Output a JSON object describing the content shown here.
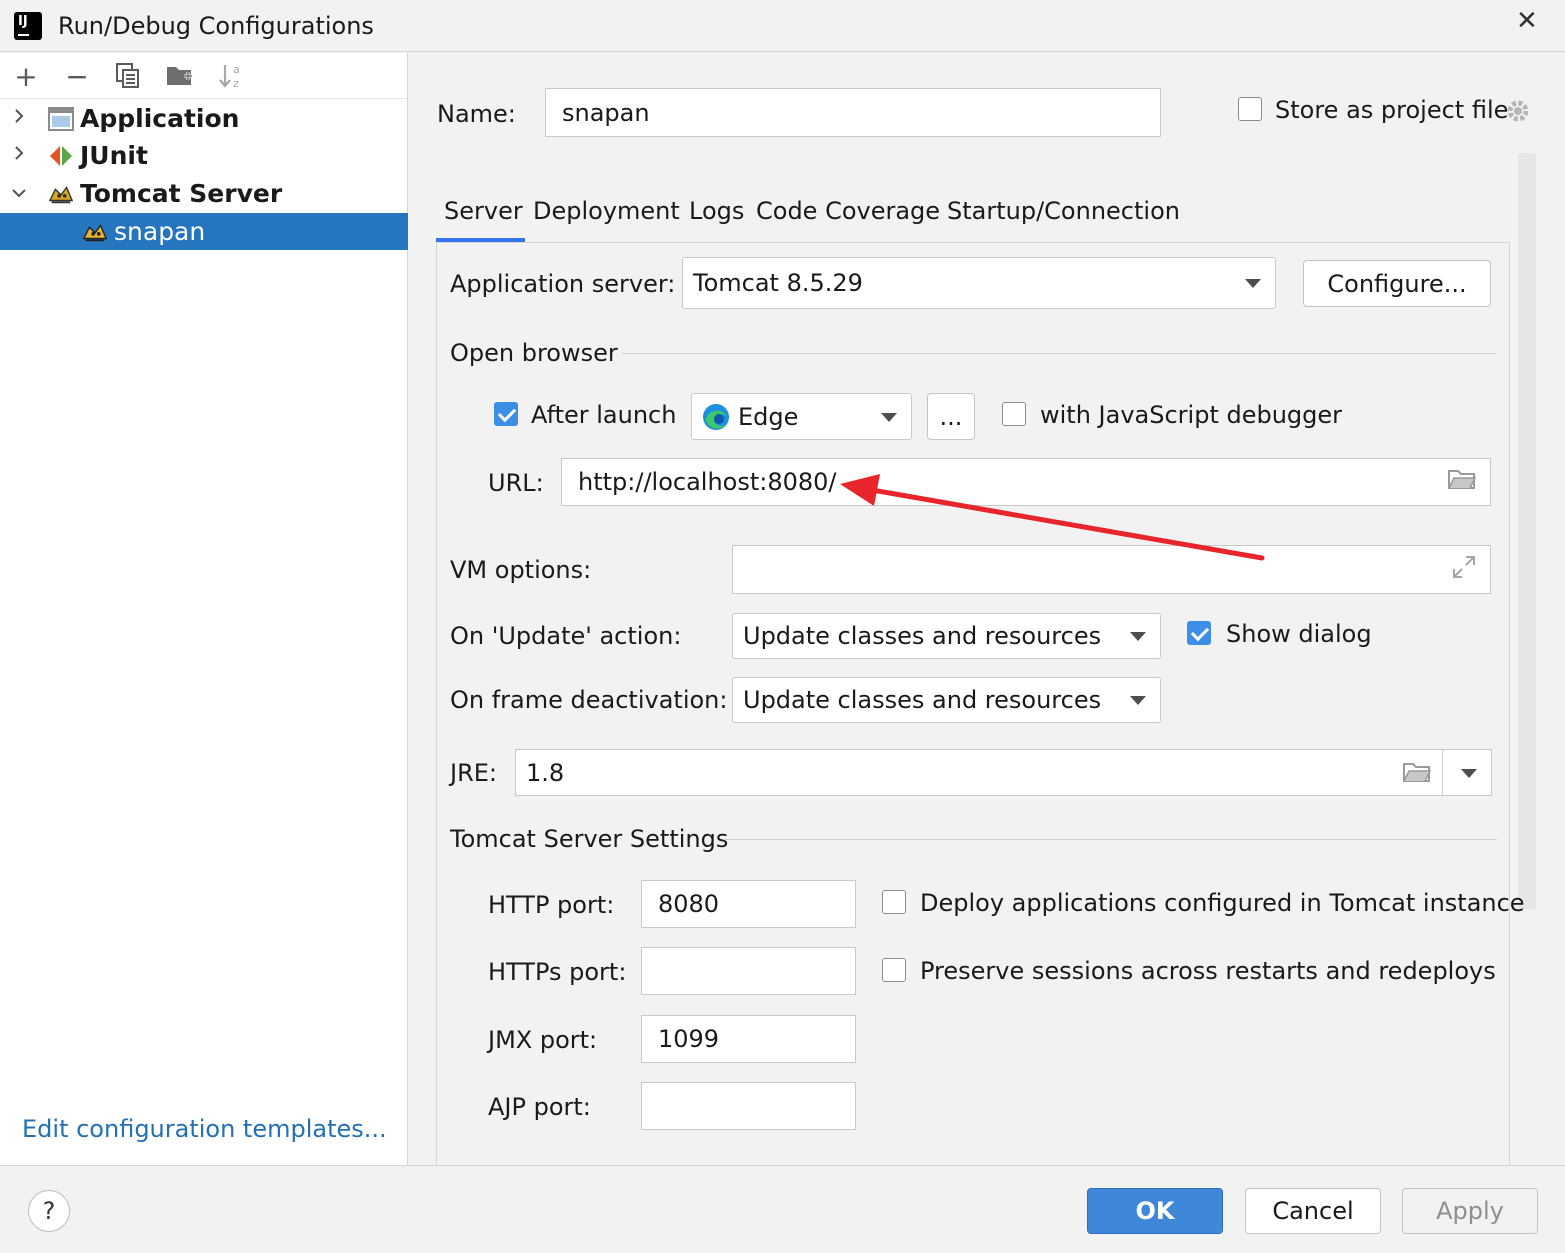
{
  "window": {
    "title": "Run/Debug Configurations",
    "close_glyph": "✕"
  },
  "left_toolbar": {
    "add": "+",
    "remove": "−"
  },
  "tree": [
    {
      "label": "Application",
      "expanded": false,
      "icon": "application-icon"
    },
    {
      "label": "JUnit",
      "expanded": false,
      "icon": "junit-icon"
    },
    {
      "label": "Tomcat Server",
      "expanded": true,
      "icon": "tomcat-icon"
    },
    {
      "label": "snapan",
      "selected": true,
      "icon": "tomcat-icon"
    }
  ],
  "edit_templates_link": "Edit configuration templates...",
  "name": {
    "label": "Name:",
    "value": "snapan"
  },
  "store_as_project_file": {
    "label": "Store as project file",
    "checked": false
  },
  "tabs": [
    "Server",
    "Deployment",
    "Logs",
    "Code Coverage",
    "Startup/Connection"
  ],
  "active_tab": "Server",
  "server": {
    "app_server_label": "Application server:",
    "app_server_value": "Tomcat 8.5.29",
    "configure_button": "Configure...",
    "open_browser_section": "Open browser",
    "after_launch_label": "After launch",
    "after_launch_checked": true,
    "browser_value": "Edge",
    "ellipsis_button": "...",
    "js_debugger_label": "with JavaScript debugger",
    "js_debugger_checked": false,
    "url_label": "URL:",
    "url_value": "http://localhost:8080/",
    "vm_options_label": "VM options:",
    "vm_options_value": "",
    "on_update_label": "On 'Update' action:",
    "on_update_value": "Update classes and resources",
    "show_dialog_label": "Show dialog",
    "show_dialog_checked": true,
    "on_frame_label": "On frame deactivation:",
    "on_frame_value": "Update classes and resources",
    "jre_label": "JRE:",
    "jre_value": "1.8",
    "tomcat_settings_section": "Tomcat Server Settings",
    "http_port_label": "HTTP port:",
    "http_port_value": "8080",
    "https_port_label": "HTTPs port:",
    "https_port_value": "",
    "jmx_port_label": "JMX port:",
    "jmx_port_value": "1099",
    "ajp_port_label": "AJP port:",
    "ajp_port_value": "",
    "deploy_apps_label": "Deploy applications configured in Tomcat instance",
    "deploy_apps_checked": false,
    "preserve_sessions_label": "Preserve sessions across restarts and redeploys",
    "preserve_sessions_checked": false
  },
  "buttons": {
    "help": "?",
    "ok": "OK",
    "cancel": "Cancel",
    "apply": "Apply"
  },
  "colors": {
    "selection": "#2675bf",
    "accent": "#3574f0",
    "ok_button": "#3f87d9",
    "annotation_arrow": "#e8252b"
  }
}
